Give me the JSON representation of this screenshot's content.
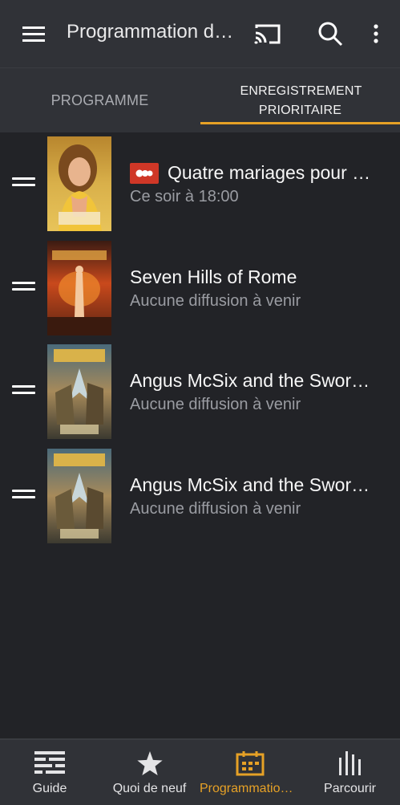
{
  "header": {
    "title": "Programmation de...",
    "menu_icon": "hamburger-menu-icon",
    "cast_icon": "cast-icon",
    "search_icon": "search-icon",
    "more_icon": "more-vert-icon"
  },
  "tabs": [
    {
      "label": "PROGRAMME",
      "active": false
    },
    {
      "label": "ENREGISTREMENT PRIORITAIRE",
      "active": true
    }
  ],
  "recordings": [
    {
      "title": "Quatre mariages pour u...",
      "subtitle": "Ce soir à 18:00",
      "recording": true,
      "poster_text": "4 MARIAGES"
    },
    {
      "title": "Seven Hills of Rome",
      "subtitle": "Aucune diffusion à venir",
      "recording": false,
      "poster_text": "Seven Hills"
    },
    {
      "title": "Angus McSix and the Sword o...",
      "subtitle": "Aucune diffusion à venir",
      "recording": false,
      "poster_text": "ANGUS McSIX"
    },
    {
      "title": "Angus McSix and the Sword o...",
      "subtitle": "Aucune diffusion à venir",
      "recording": false,
      "poster_text": "ANGUS McSIX"
    }
  ],
  "bottom_nav": [
    {
      "label": "Guide",
      "icon": "guide-icon",
      "active": false
    },
    {
      "label": "Quoi de neuf",
      "icon": "star-icon",
      "active": false
    },
    {
      "label": "Programmation ...",
      "icon": "calendar-icon",
      "active": true
    },
    {
      "label": "Parcourir",
      "icon": "browse-icon",
      "active": false
    }
  ],
  "colors": {
    "accent": "#e6a126",
    "record": "#cf3727",
    "background": "#222327",
    "bar": "#303237"
  }
}
